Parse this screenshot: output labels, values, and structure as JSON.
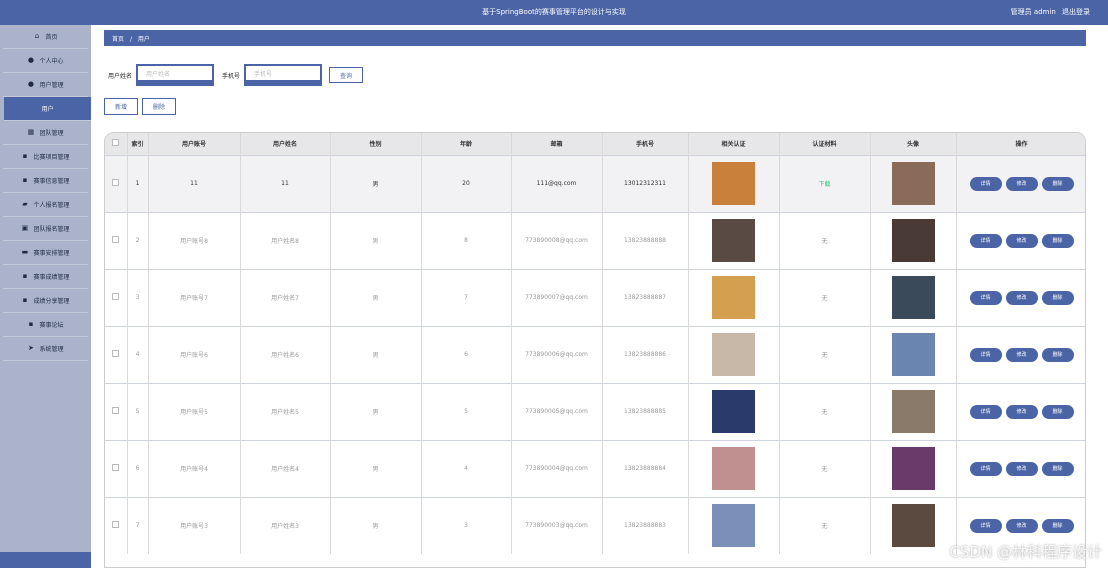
{
  "header": {
    "title": "基于SpringBoot的赛事管理平台的设计与实现",
    "user_label": "管理员 admin",
    "logout": "退出登录"
  },
  "sidebar": {
    "items": [
      {
        "label": "首页",
        "icon": "home-icon",
        "glyph": "⌂"
      },
      {
        "label": "个人中心",
        "icon": "user-icon",
        "glyph": "●"
      },
      {
        "label": "用户管理",
        "icon": "user-icon",
        "glyph": "●"
      },
      {
        "label": "用户",
        "icon": "",
        "glyph": ""
      },
      {
        "label": "团队管理",
        "icon": "calendar-icon",
        "glyph": "▦"
      },
      {
        "label": "比赛项目管理",
        "icon": "grid-icon",
        "glyph": "▪"
      },
      {
        "label": "赛事信息管理",
        "icon": "grid-icon",
        "glyph": "▪"
      },
      {
        "label": "个人报名管理",
        "icon": "chat-icon",
        "glyph": "▰"
      },
      {
        "label": "团队报名管理",
        "icon": "document-icon",
        "glyph": "▣"
      },
      {
        "label": "赛事安排管理",
        "icon": "monitor-icon",
        "glyph": "▬"
      },
      {
        "label": "赛事成绩管理",
        "icon": "grid-icon",
        "glyph": "▪"
      },
      {
        "label": "成绩分享管理",
        "icon": "grid-icon",
        "glyph": "▪"
      },
      {
        "label": "赛事论坛",
        "icon": "grid-icon",
        "glyph": "▪"
      },
      {
        "label": "系统管理",
        "icon": "send-icon",
        "glyph": "➤"
      }
    ]
  },
  "breadcrumb": {
    "home": "首页",
    "sep": "/",
    "current": "用户"
  },
  "search": {
    "label1": "用户姓名",
    "placeholder1": "用户姓名",
    "label2": "手机号",
    "placeholder2": "手机号",
    "button": "查询"
  },
  "actions": {
    "add": "新增",
    "delete": "删除"
  },
  "table": {
    "headers": [
      "",
      "索引",
      "用户账号",
      "用户姓名",
      "性别",
      "年龄",
      "邮箱",
      "手机号",
      "相关认证",
      "认证材料",
      "头像",
      "操作"
    ],
    "rows": [
      {
        "index": "1",
        "account": "11",
        "name": "11",
        "gender": "男",
        "age": "20",
        "email": "111@qq.com",
        "phone": "13012312311",
        "material": "下载",
        "cert_color": "#c9803a",
        "avatar_color": "#8a6b5a"
      },
      {
        "index": "2",
        "account": "用户账号8",
        "name": "用户姓名8",
        "gender": "男",
        "age": "8",
        "email": "773890008@qq.com",
        "phone": "13823888888",
        "material": "无",
        "cert_color": "#5a4a44",
        "avatar_color": "#4a3a36"
      },
      {
        "index": "3",
        "account": "用户账号7",
        "name": "用户姓名7",
        "gender": "男",
        "age": "7",
        "email": "773890007@qq.com",
        "phone": "13823888887",
        "material": "无",
        "cert_color": "#d4a050",
        "avatar_color": "#3a4a5a"
      },
      {
        "index": "4",
        "account": "用户账号6",
        "name": "用户姓名6",
        "gender": "男",
        "age": "6",
        "email": "773890006@qq.com",
        "phone": "13823888886",
        "material": "无",
        "cert_color": "#c8b8a8",
        "avatar_color": "#6a86b0"
      },
      {
        "index": "5",
        "account": "用户账号5",
        "name": "用户姓名5",
        "gender": "男",
        "age": "5",
        "email": "773890005@qq.com",
        "phone": "13823888885",
        "material": "无",
        "cert_color": "#2a3a6a",
        "avatar_color": "#8a7a6a"
      },
      {
        "index": "6",
        "account": "用户账号4",
        "name": "用户姓名4",
        "gender": "男",
        "age": "4",
        "email": "773890004@qq.com",
        "phone": "13823888884",
        "material": "无",
        "cert_color": "#c09090",
        "avatar_color": "#6a3a6a"
      },
      {
        "index": "7",
        "account": "用户账号3",
        "name": "用户姓名3",
        "gender": "男",
        "age": "3",
        "email": "773890003@qq.com",
        "phone": "13823888883",
        "material": "无",
        "cert_color": "#7a90b8",
        "avatar_color": "#5a4a40"
      }
    ],
    "ops": {
      "detail": "详情",
      "edit": "修改",
      "delete": "删除"
    }
  },
  "watermark": "CSDN @林科程序设计"
}
